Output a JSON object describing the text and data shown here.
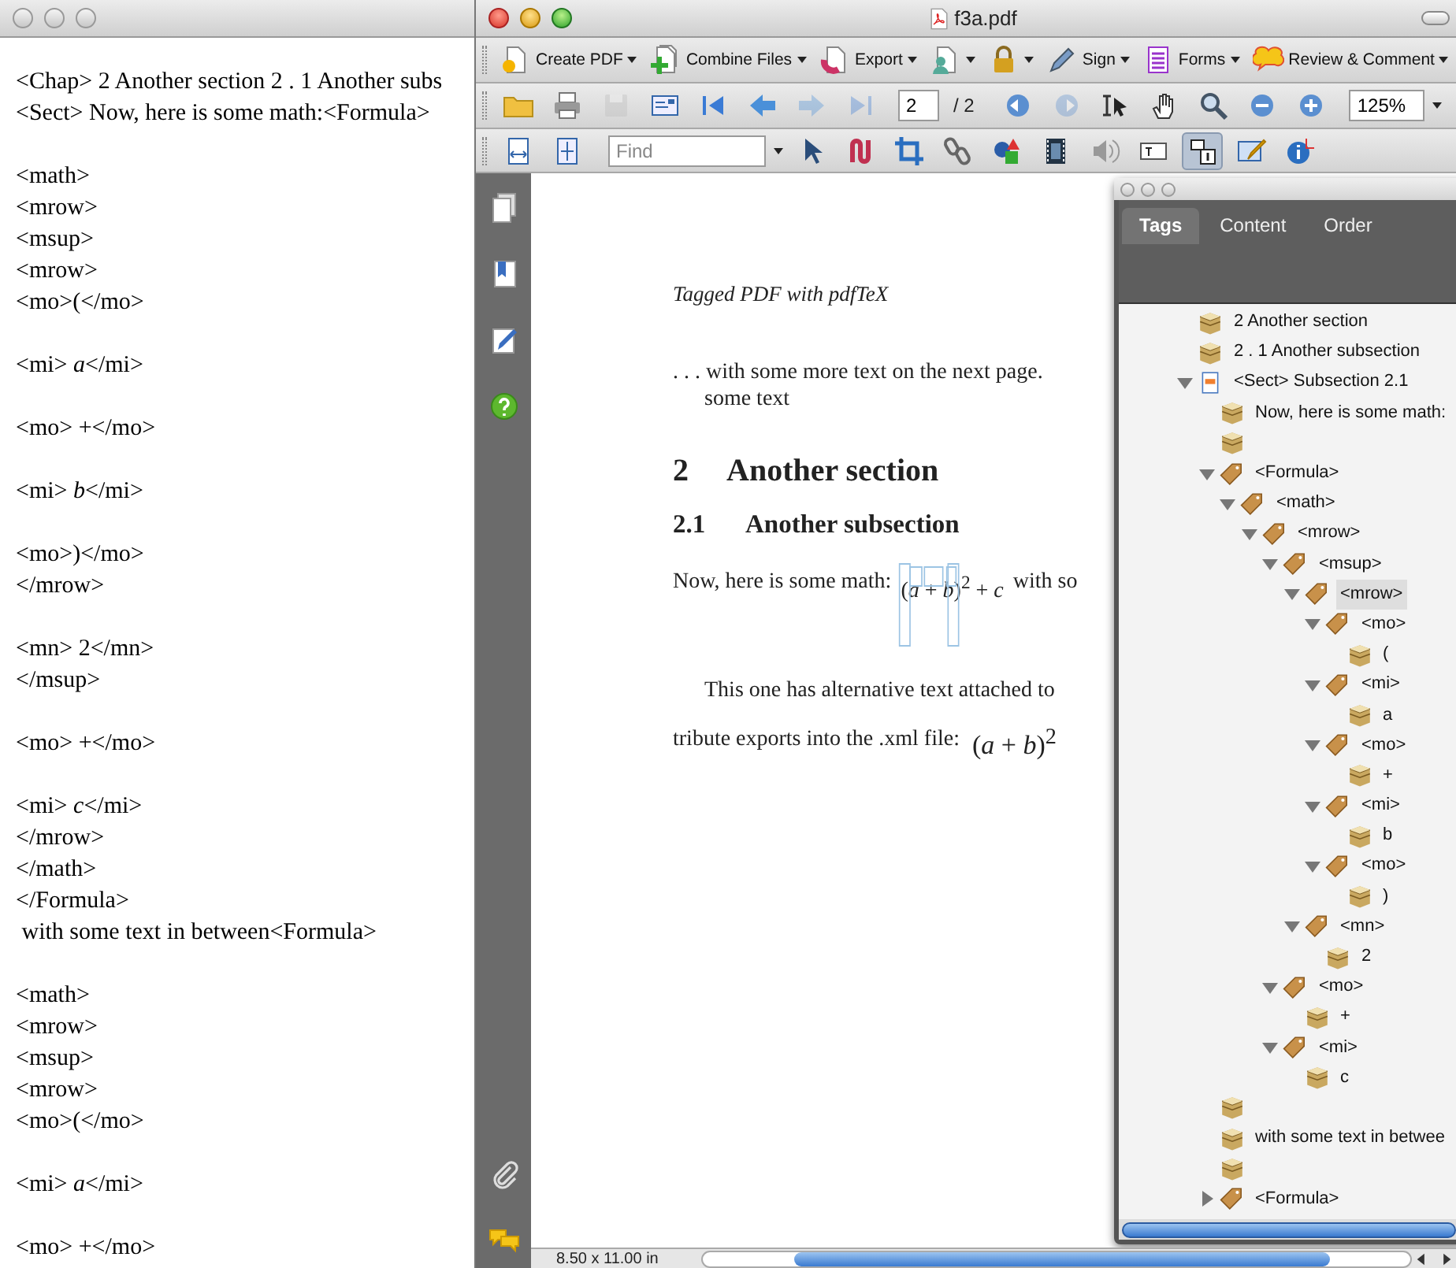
{
  "editor": {
    "paragraphs": [
      [
        "<Chap> 2 Another section 2 . 1 Another subs",
        "<Sect> Now, here is some math:<Formula>"
      ],
      [
        "<math>",
        "<mrow>",
        "<msup>",
        "<mrow>",
        "<mo>(</mo>"
      ],
      [
        "<mi> *a*</mi>"
      ],
      [
        "<mo> +</mo>"
      ],
      [
        "<mi> *b*</mi>"
      ],
      [
        "<mo>)</mo>",
        "</mrow>"
      ],
      [
        "<mn> 2</mn>",
        "</msup>"
      ],
      [
        "<mo> +</mo>"
      ],
      [
        "<mi> *c*</mi>",
        "</mrow>",
        "</math>",
        "</Formula>",
        " with some text in between<Formula>"
      ],
      [
        "<math>",
        "<mrow>",
        "<msup>",
        "<mrow>",
        "<mo>(</mo>"
      ],
      [
        "<mi> *a*</mi>"
      ],
      [
        "<mo> +</mo>"
      ]
    ]
  },
  "pdf": {
    "title": "f3a.pdf",
    "toolbar": [
      [
        {
          "kind": "button",
          "label": "Create PDF",
          "menu": true,
          "disabled": false,
          "selected": false
        },
        {
          "kind": "button",
          "label": "Combine Files",
          "menu": true,
          "disabled": false,
          "selected": false
        },
        {
          "kind": "button",
          "label": "Export",
          "menu": true,
          "disabled": false,
          "selected": false
        },
        {
          "kind": "button",
          "menu": true,
          "disabled": false,
          "selected": false
        },
        {
          "kind": "button",
          "menu": true,
          "disabled": false,
          "selected": false
        },
        {
          "kind": "button",
          "label": "Sign",
          "menu": true,
          "disabled": false,
          "selected": false
        },
        {
          "kind": "button",
          "label": "Forms",
          "menu": true,
          "disabled": false,
          "selected": false
        },
        {
          "kind": "button",
          "label": "Review & Comment",
          "menu": true,
          "disabled": false,
          "selected": false
        }
      ],
      [
        {
          "kind": "button",
          "disabled": false,
          "selected": false
        },
        {
          "kind": "button",
          "disabled": false,
          "selected": false
        },
        {
          "kind": "button",
          "disabled": true,
          "selected": false
        },
        {
          "kind": "button",
          "disabled": false,
          "selected": false
        },
        {
          "kind": "button",
          "disabled": false,
          "selected": false
        },
        {
          "kind": "button",
          "disabled": false,
          "selected": false
        },
        {
          "kind": "button",
          "disabled": true,
          "selected": false
        },
        {
          "kind": "button",
          "disabled": true,
          "selected": false
        },
        {
          "kind": "field",
          "value": "2"
        },
        {
          "kind": "label",
          "text": "/ 2"
        },
        {
          "kind": "button",
          "disabled": false,
          "selected": false
        },
        {
          "kind": "button",
          "disabled": true,
          "selected": false
        },
        {
          "kind": "button",
          "disabled": false,
          "selected": false
        },
        {
          "kind": "button",
          "disabled": false,
          "selected": false
        },
        {
          "kind": "button",
          "disabled": false,
          "selected": false
        },
        {
          "kind": "button",
          "disabled": false,
          "selected": false
        },
        {
          "kind": "button",
          "disabled": false,
          "selected": false
        },
        {
          "kind": "field",
          "value": "125%",
          "menu": true
        }
      ],
      [
        {
          "kind": "button",
          "disabled": false,
          "selected": false
        },
        {
          "kind": "button",
          "disabled": false,
          "selected": false
        },
        {
          "kind": "field",
          "placeholder": "Find",
          "menu": true
        },
        {
          "kind": "button",
          "disabled": false,
          "selected": false
        },
        {
          "kind": "button",
          "disabled": false,
          "selected": false
        },
        {
          "kind": "button",
          "disabled": false,
          "selected": false
        },
        {
          "kind": "button",
          "disabled": false,
          "selected": false
        },
        {
          "kind": "button",
          "disabled": false,
          "selected": false
        },
        {
          "kind": "button",
          "disabled": false,
          "selected": false
        },
        {
          "kind": "button",
          "disabled": false,
          "selected": false
        },
        {
          "kind": "button",
          "disabled": false,
          "selected": false
        },
        {
          "kind": "button",
          "disabled": false,
          "selected": true
        },
        {
          "kind": "button",
          "disabled": false,
          "selected": false
        },
        {
          "kind": "button",
          "disabled": false,
          "selected": false
        }
      ]
    ],
    "page": [
      {
        "kind": "running-head",
        "text": "Tagged PDF with pdfTeX"
      },
      {
        "kind": "text",
        "text": ". . . with some more text on the next page."
      },
      {
        "kind": "continuation",
        "text": "some text"
      },
      {
        "kind": "section",
        "number": "2",
        "text": "Another section"
      },
      {
        "kind": "subsection",
        "number": "2.1",
        "text": "Another subsection"
      },
      {
        "kind": "math",
        "text": "Now, here is some math:",
        "formula": "(*a* + *b*)$^{2}$ + *c*",
        "after": "with so"
      },
      {
        "kind": "paragraph",
        "text": "This one has alternative text attached to"
      },
      {
        "kind": "display",
        "text": "tribute exports into the .xml file:",
        "formula": "(*a* + *b*)$^{2}$"
      }
    ],
    "tags_panel": {
      "tabs": [
        {
          "label": "Tags",
          "selected": true
        },
        {
          "label": "Content",
          "selected": false
        },
        {
          "label": "Order",
          "selected": false
        }
      ],
      "tree": [
        {
          "kind": "content",
          "label": "2 Another section",
          "selected": false
        },
        {
          "kind": "content",
          "label": "2 . 1 Another subsection",
          "selected": false
        },
        {
          "kind": "sect",
          "label": "<Sect> Subsection 2.1",
          "expanded": true,
          "selected": false,
          "children": [
            {
              "kind": "content",
              "label": "Now, here is some math:",
              "selected": false
            },
            {
              "kind": "content",
              "selected": false
            },
            {
              "kind": "tag",
              "label": "<Formula>",
              "expanded": true,
              "selected": false,
              "children": [
                {
                  "kind": "tag",
                  "label": "<math>",
                  "expanded": true,
                  "selected": false,
                  "children": [
                    {
                      "kind": "tag",
                      "label": "<mrow>",
                      "expanded": true,
                      "selected": false,
                      "children": [
                        {
                          "kind": "tag",
                          "label": "<msup>",
                          "expanded": true,
                          "selected": false,
                          "children": [
                            {
                              "kind": "tag",
                              "label": "<mrow>",
                              "expanded": true,
                              "selected": true,
                              "children": [
                                {
                                  "kind": "tag",
                                  "label": "<mo>",
                                  "expanded": true,
                                  "selected": false,
                                  "children": [
                                    {
                                      "kind": "content",
                                      "label": "(",
                                      "selected": false
                                    }
                                  ]
                                },
                                {
                                  "kind": "tag",
                                  "label": "<mi>",
                                  "expanded": true,
                                  "selected": false,
                                  "children": [
                                    {
                                      "kind": "content",
                                      "label": "a",
                                      "selected": false
                                    }
                                  ]
                                },
                                {
                                  "kind": "tag",
                                  "label": "<mo>",
                                  "expanded": true,
                                  "selected": false,
                                  "children": [
                                    {
                                      "kind": "content",
                                      "label": "+",
                                      "selected": false
                                    }
                                  ]
                                },
                                {
                                  "kind": "tag",
                                  "label": "<mi>",
                                  "expanded": true,
                                  "selected": false,
                                  "children": [
                                    {
                                      "kind": "content",
                                      "label": "b",
                                      "selected": false
                                    }
                                  ]
                                },
                                {
                                  "kind": "tag",
                                  "label": "<mo>",
                                  "expanded": true,
                                  "selected": false,
                                  "children": [
                                    {
                                      "kind": "content",
                                      "label": ")",
                                      "selected": false
                                    }
                                  ]
                                }
                              ]
                            },
                            {
                              "kind": "tag",
                              "label": "<mn>",
                              "expanded": true,
                              "selected": false,
                              "children": [
                                {
                                  "kind": "content",
                                  "label": "2",
                                  "selected": false
                                }
                              ]
                            }
                          ]
                        },
                        {
                          "kind": "tag",
                          "label": "<mo>",
                          "expanded": true,
                          "selected": false,
                          "children": [
                            {
                              "kind": "content",
                              "label": "+",
                              "selected": false
                            }
                          ]
                        },
                        {
                          "kind": "tag",
                          "label": "<mi>",
                          "expanded": true,
                          "selected": false,
                          "children": [
                            {
                              "kind": "content",
                              "label": "c",
                              "selected": false
                            }
                          ]
                        }
                      ]
                    }
                  ]
                }
              ]
            },
            {
              "kind": "content",
              "selected": false
            },
            {
              "kind": "content",
              "label": "with some text in betwee",
              "selected": false
            },
            {
              "kind": "content",
              "selected": false
            },
            {
              "kind": "tag",
              "label": "<Formula>",
              "expanded": false,
              "selected": false
            }
          ]
        }
      ]
    },
    "status": "8.50 x 11.00 in"
  }
}
